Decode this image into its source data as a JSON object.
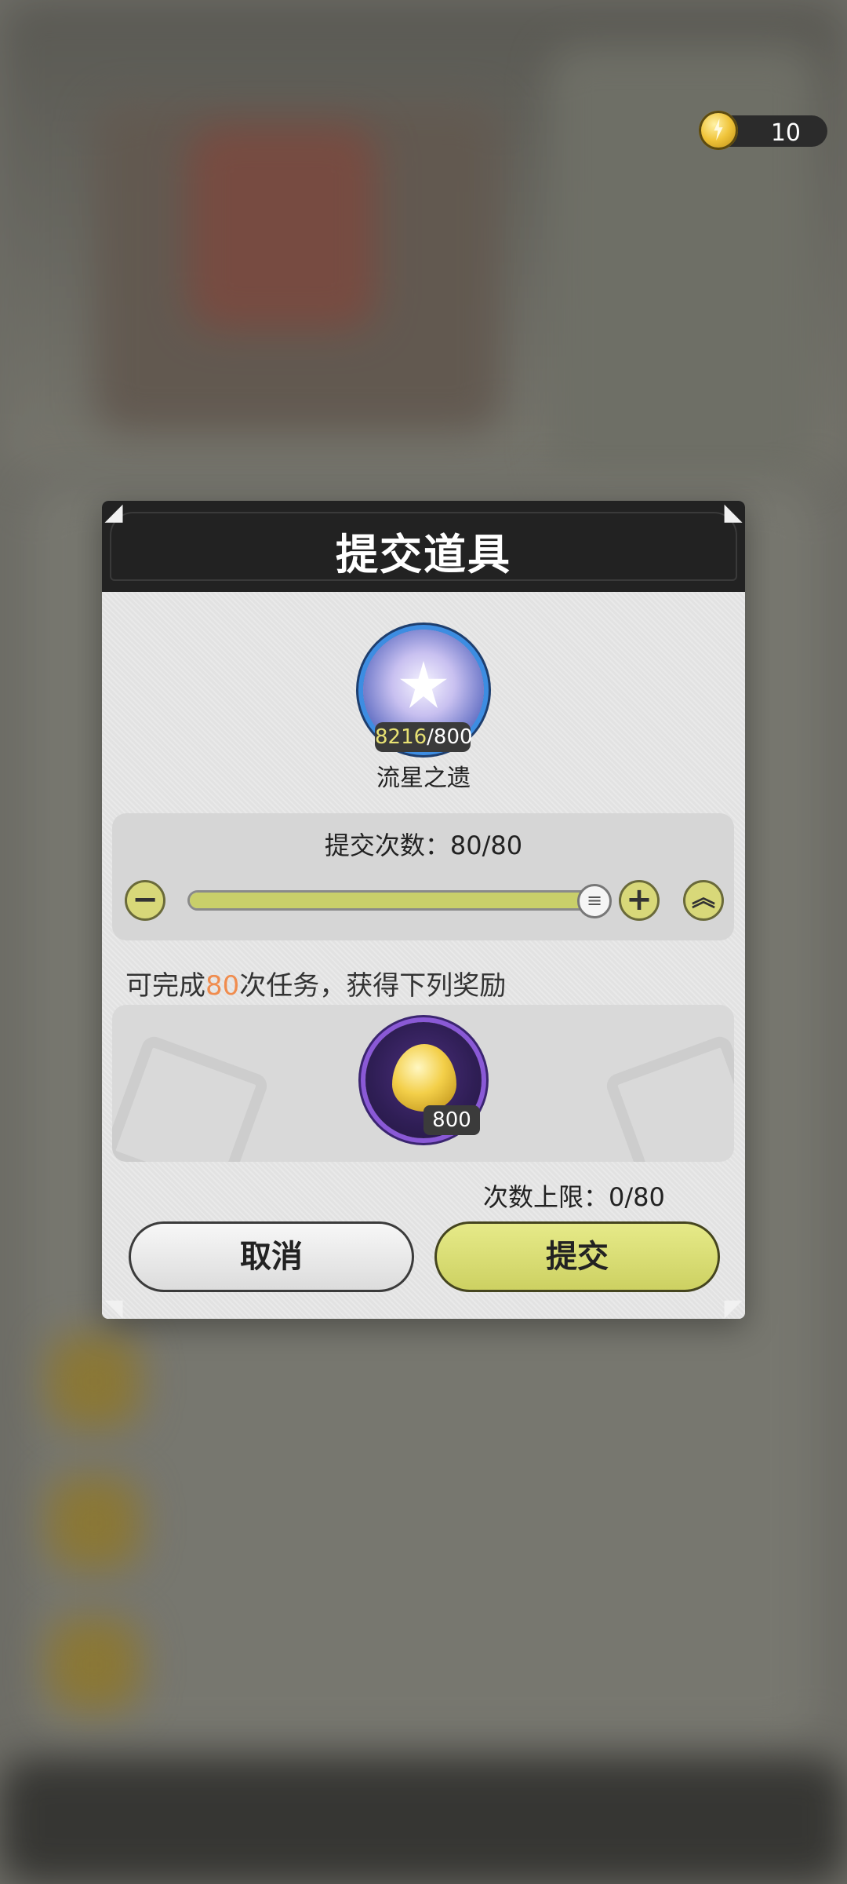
{
  "currency": {
    "icon": "lightning-coin-icon",
    "value": "10"
  },
  "modal": {
    "title": "提交道具",
    "item": {
      "icon": "meteor-remnant-icon",
      "owned": "8216",
      "required": "/800",
      "name": "流星之遗"
    },
    "submit_count": {
      "label": "提交次数：80/80",
      "current": 80,
      "max": 80,
      "decrease_icon": "minus-icon",
      "increase_icon": "plus-icon",
      "max_icon": "double-chevron-up-icon"
    },
    "task_text": {
      "prefix": "可完成",
      "count": "80",
      "suffix": "次任务，获得下列奖励"
    },
    "reward": {
      "icon": "golden-leaf-icon",
      "count": "800"
    },
    "limit_text": "次数上限：0/80",
    "cancel_label": "取消",
    "submit_label": "提交"
  },
  "colors": {
    "highlight": "#f08c4e",
    "accent_button": "#d6d96f",
    "header": "#222222"
  }
}
